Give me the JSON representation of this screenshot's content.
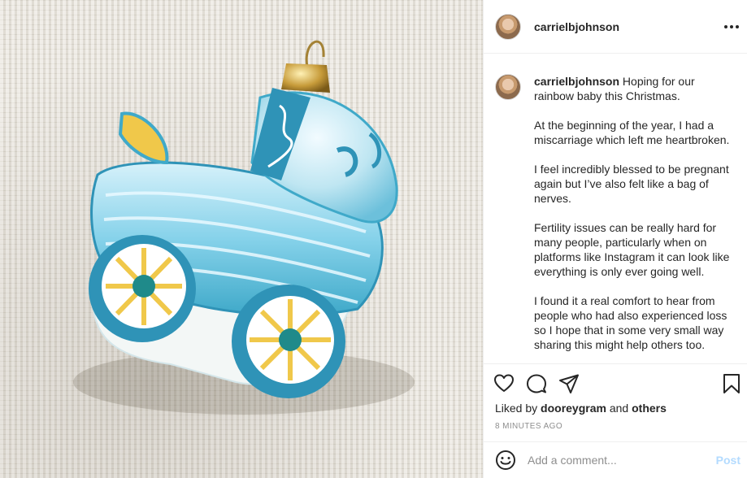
{
  "post": {
    "photo_alt": "Blue glass baby-carriage Christmas ornament",
    "author": "carrielbjohnson"
  },
  "header": {
    "username": "carrielbjohnson",
    "more_icon": "more-horizontal-icon"
  },
  "caption": {
    "username": "carrielbjohnson",
    "first_line": "Hoping for our rainbow baby this Christmas.",
    "paragraphs": [
      "At the beginning of the year, I had a miscarriage which left me heartbroken.",
      "I feel incredibly blessed to be pregnant again but I’ve also felt like a bag of nerves.",
      "Fertility issues can be really hard for many people, particularly when on platforms like Instagram it can look like everything is only ever going well.",
      "I found it a real comfort to hear from people who had also experienced loss so I hope that in some very small way sharing this might help others too."
    ]
  },
  "actions": {
    "icons": [
      "heart-icon",
      "comment-icon",
      "share-icon",
      "bookmark-icon"
    ],
    "liked_by_prefix": "Liked by ",
    "liked_by_user": "dooreygram",
    "liked_by_and": " and ",
    "liked_by_others": "others",
    "timestamp": "8 MINUTES AGO"
  },
  "comment_box": {
    "placeholder": "Add a comment...",
    "post_label": "Post",
    "emoji_icon": "smiley-icon"
  },
  "colors": {
    "accent_disabled": "#b3dbff",
    "text": "#262626",
    "muted": "#8e8e8e",
    "ornament_blue": "#3fa9c9"
  }
}
